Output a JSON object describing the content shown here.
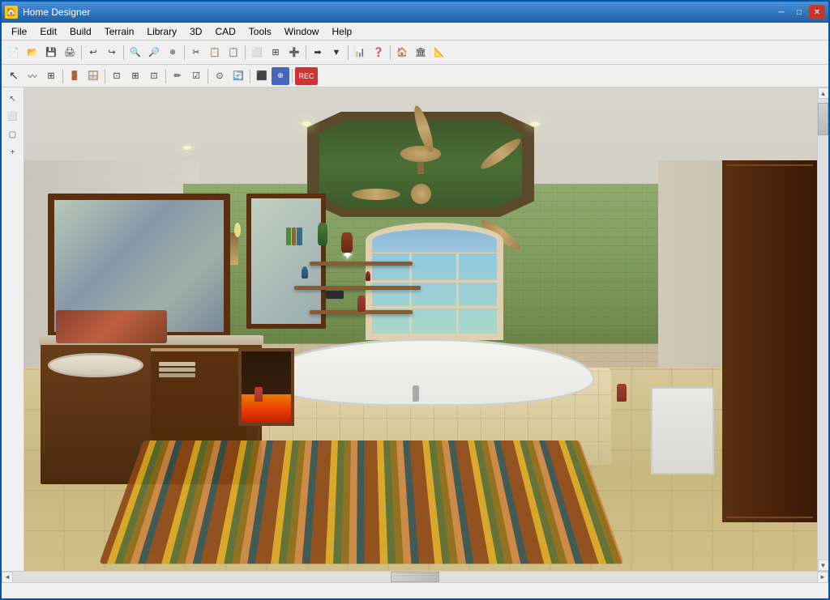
{
  "window": {
    "title": "Home Designer",
    "icon": "🏠"
  },
  "titlebar": {
    "title": "Home Designer",
    "min_label": "─",
    "max_label": "□",
    "close_label": "✕"
  },
  "menubar": {
    "items": [
      "File",
      "Edit",
      "Build",
      "Terrain",
      "Library",
      "3D",
      "CAD",
      "Tools",
      "Window",
      "Help"
    ]
  },
  "toolbar1": {
    "buttons": [
      "📄",
      "📁",
      "💾",
      "🖨️",
      "↩",
      "↪",
      "🔍",
      "🔎",
      "🔍",
      "⊕",
      "✂",
      "📋",
      "📋",
      "⬜",
      "⊞",
      "➕",
      "➡",
      "🔽",
      "📊",
      "❓",
      "🏠",
      "🏠",
      "📐"
    ]
  },
  "toolbar2": {
    "buttons": [
      "↖",
      "〰",
      "⊞",
      "⊟",
      "⬜",
      "⊞",
      "⊡",
      "⊞",
      "⊡",
      "✏",
      "☑",
      "⊙",
      "🔄",
      "⬛",
      "⊕",
      "REC"
    ]
  },
  "statusbar": {
    "text": ""
  },
  "scene": {
    "type": "3d_room",
    "description": "3D rendered bathroom interior",
    "room": "luxury bathroom",
    "colors": {
      "ceiling": "#d8d5cc",
      "back_wall_green": "#7a9558",
      "back_wall_tile": "#c8b89a",
      "left_wall": "#ccc6b8",
      "floor": "#c8b888",
      "cabinet": "#4a2a0e",
      "octagon": "#5a4a2a",
      "octagon_inner": "#4a6e35",
      "rug_colors": [
        "#8B4513",
        "#DAA520",
        "#556B2F",
        "#8B6914",
        "#CD853F"
      ]
    }
  }
}
